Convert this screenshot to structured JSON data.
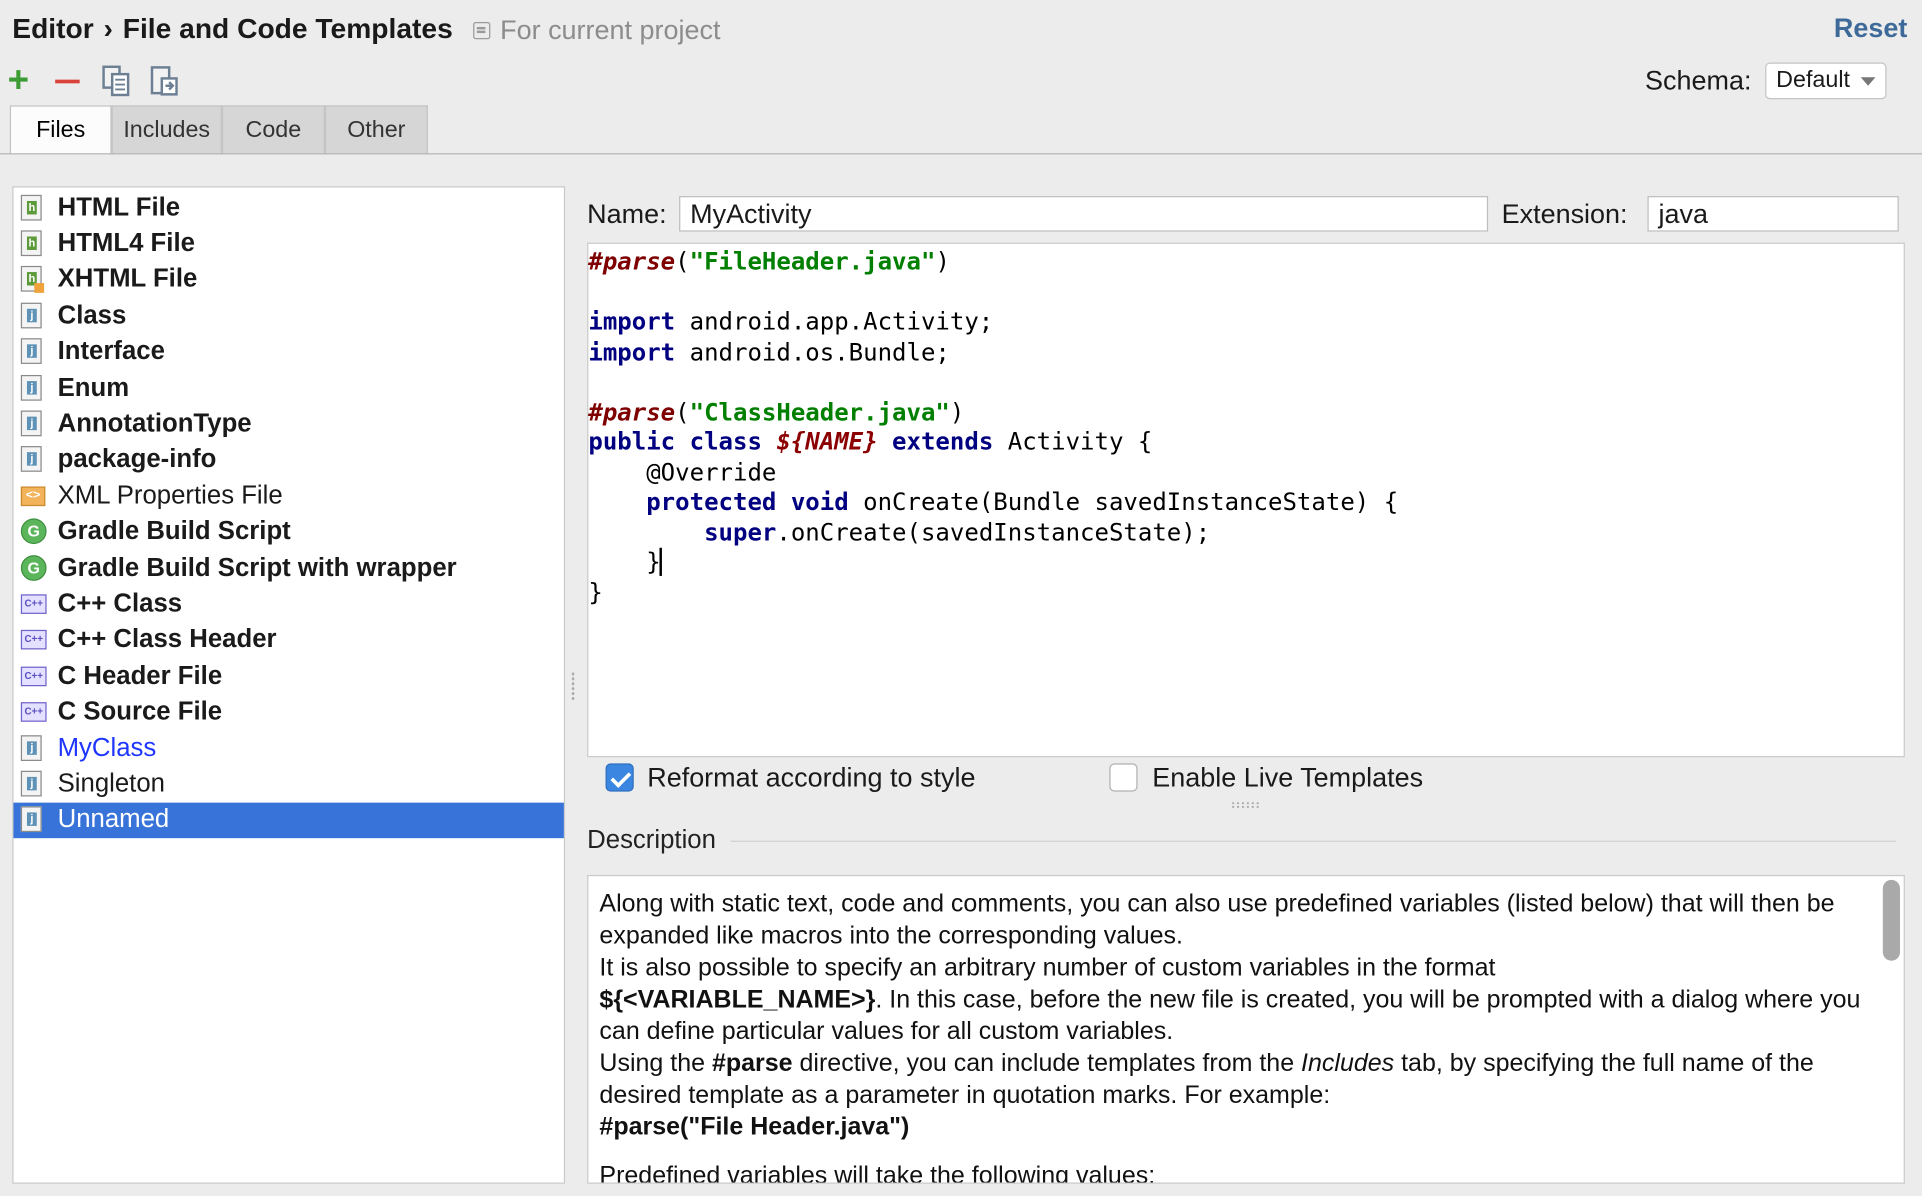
{
  "breadcrumb": {
    "parent": "Editor",
    "separator": "›",
    "current": "File and Code Templates"
  },
  "scope_label": "For current project",
  "reset_label": "Reset",
  "toolbar": {
    "add_icon": "plus-icon",
    "remove_icon": "minus-icon",
    "copy_icon": "copy-icon",
    "export_icon": "export-icon"
  },
  "schema": {
    "label": "Schema:",
    "value": "Default"
  },
  "tabs": [
    {
      "label": "Files",
      "active": true
    },
    {
      "label": "Includes",
      "active": false
    },
    {
      "label": "Code",
      "active": false
    },
    {
      "label": "Other",
      "active": false
    }
  ],
  "templates": [
    {
      "label": "HTML File",
      "icon": "html-file-icon",
      "bold": true
    },
    {
      "label": "HTML4 File",
      "icon": "html-file-icon",
      "bold": true
    },
    {
      "label": "XHTML File",
      "icon": "xhtml-file-icon",
      "bold": true
    },
    {
      "label": "Class",
      "icon": "java-file-icon",
      "bold": true
    },
    {
      "label": "Interface",
      "icon": "java-file-icon",
      "bold": true
    },
    {
      "label": "Enum",
      "icon": "java-file-icon",
      "bold": true
    },
    {
      "label": "AnnotationType",
      "icon": "java-file-icon",
      "bold": true
    },
    {
      "label": "package-info",
      "icon": "java-file-icon",
      "bold": true
    },
    {
      "label": "XML Properties File",
      "icon": "xml-file-icon",
      "bold": false
    },
    {
      "label": "Gradle Build Script",
      "icon": "gradle-icon",
      "bold": true
    },
    {
      "label": "Gradle Build Script with wrapper",
      "icon": "gradle-icon",
      "bold": true
    },
    {
      "label": "C++ Class",
      "icon": "cpp-file-icon",
      "bold": true
    },
    {
      "label": "C++ Class Header",
      "icon": "cpp-file-icon",
      "bold": true
    },
    {
      "label": "C Header File",
      "icon": "cpp-file-icon",
      "bold": true
    },
    {
      "label": "C Source File",
      "icon": "cpp-file-icon",
      "bold": true
    },
    {
      "label": "MyClass",
      "icon": "java-file-icon",
      "bold": false,
      "blue": true
    },
    {
      "label": "Singleton",
      "icon": "java-file-icon",
      "bold": false
    },
    {
      "label": "Unnamed",
      "icon": "java-file-icon",
      "bold": false,
      "selected": true
    }
  ],
  "name_field": {
    "label": "Name:",
    "value": "MyActivity"
  },
  "extension_field": {
    "label": "Extension:",
    "value": "java"
  },
  "code": {
    "l1_dir": "#parse",
    "l1_open": "(",
    "l1_str": "\"FileHeader.java\"",
    "l1_close": ")",
    "l3_kw": "import",
    "l3_rest": " android.app.Activity;",
    "l4_kw": "import",
    "l4_rest": " android.os.Bundle;",
    "l6_dir": "#parse",
    "l6_open": "(",
    "l6_str": "\"ClassHeader.java\"",
    "l6_close": ")",
    "l7_kw1": "public",
    "l7_kw2": "class",
    "l7_var": "${NAME}",
    "l7_kw3": "extends",
    "l7_rest": " Activity {",
    "l8": "    @Override",
    "l9_kw1": "protected",
    "l9_kw2": "void",
    "l9_rest": " onCreate(Bundle savedInstanceState) {",
    "l10_kw": "super",
    "l10_rest": ".onCreate(savedInstanceState);",
    "l11": "}",
    "l12": "}"
  },
  "options": {
    "reformat_label": "Reformat according to style",
    "reformat_checked": true,
    "live_templates_label": "Enable Live Templates",
    "live_templates_checked": false
  },
  "description": {
    "title": "Description",
    "p1": "Along with static text, code and comments, you can also use predefined variables (listed below) that will then be expanded like macros into the corresponding values.",
    "p2": "It is also possible to specify an arbitrary number of custom variables in the format",
    "p3_bold": "${<VARIABLE_NAME>}",
    "p3_rest": ". In this case, before the new file is created, you will be prompted with a dialog where you can define particular values for all custom variables.",
    "p4_a": "Using the ",
    "p4_bold": "#parse",
    "p4_b": " directive, you can include templates from the ",
    "p4_italic": "Includes",
    "p4_c": " tab, by specifying the full name of the desired template as a parameter in quotation marks. For example:",
    "p5_bold": "#parse(\"File Header.java\")",
    "p6": "Predefined variables will take the following values:"
  }
}
